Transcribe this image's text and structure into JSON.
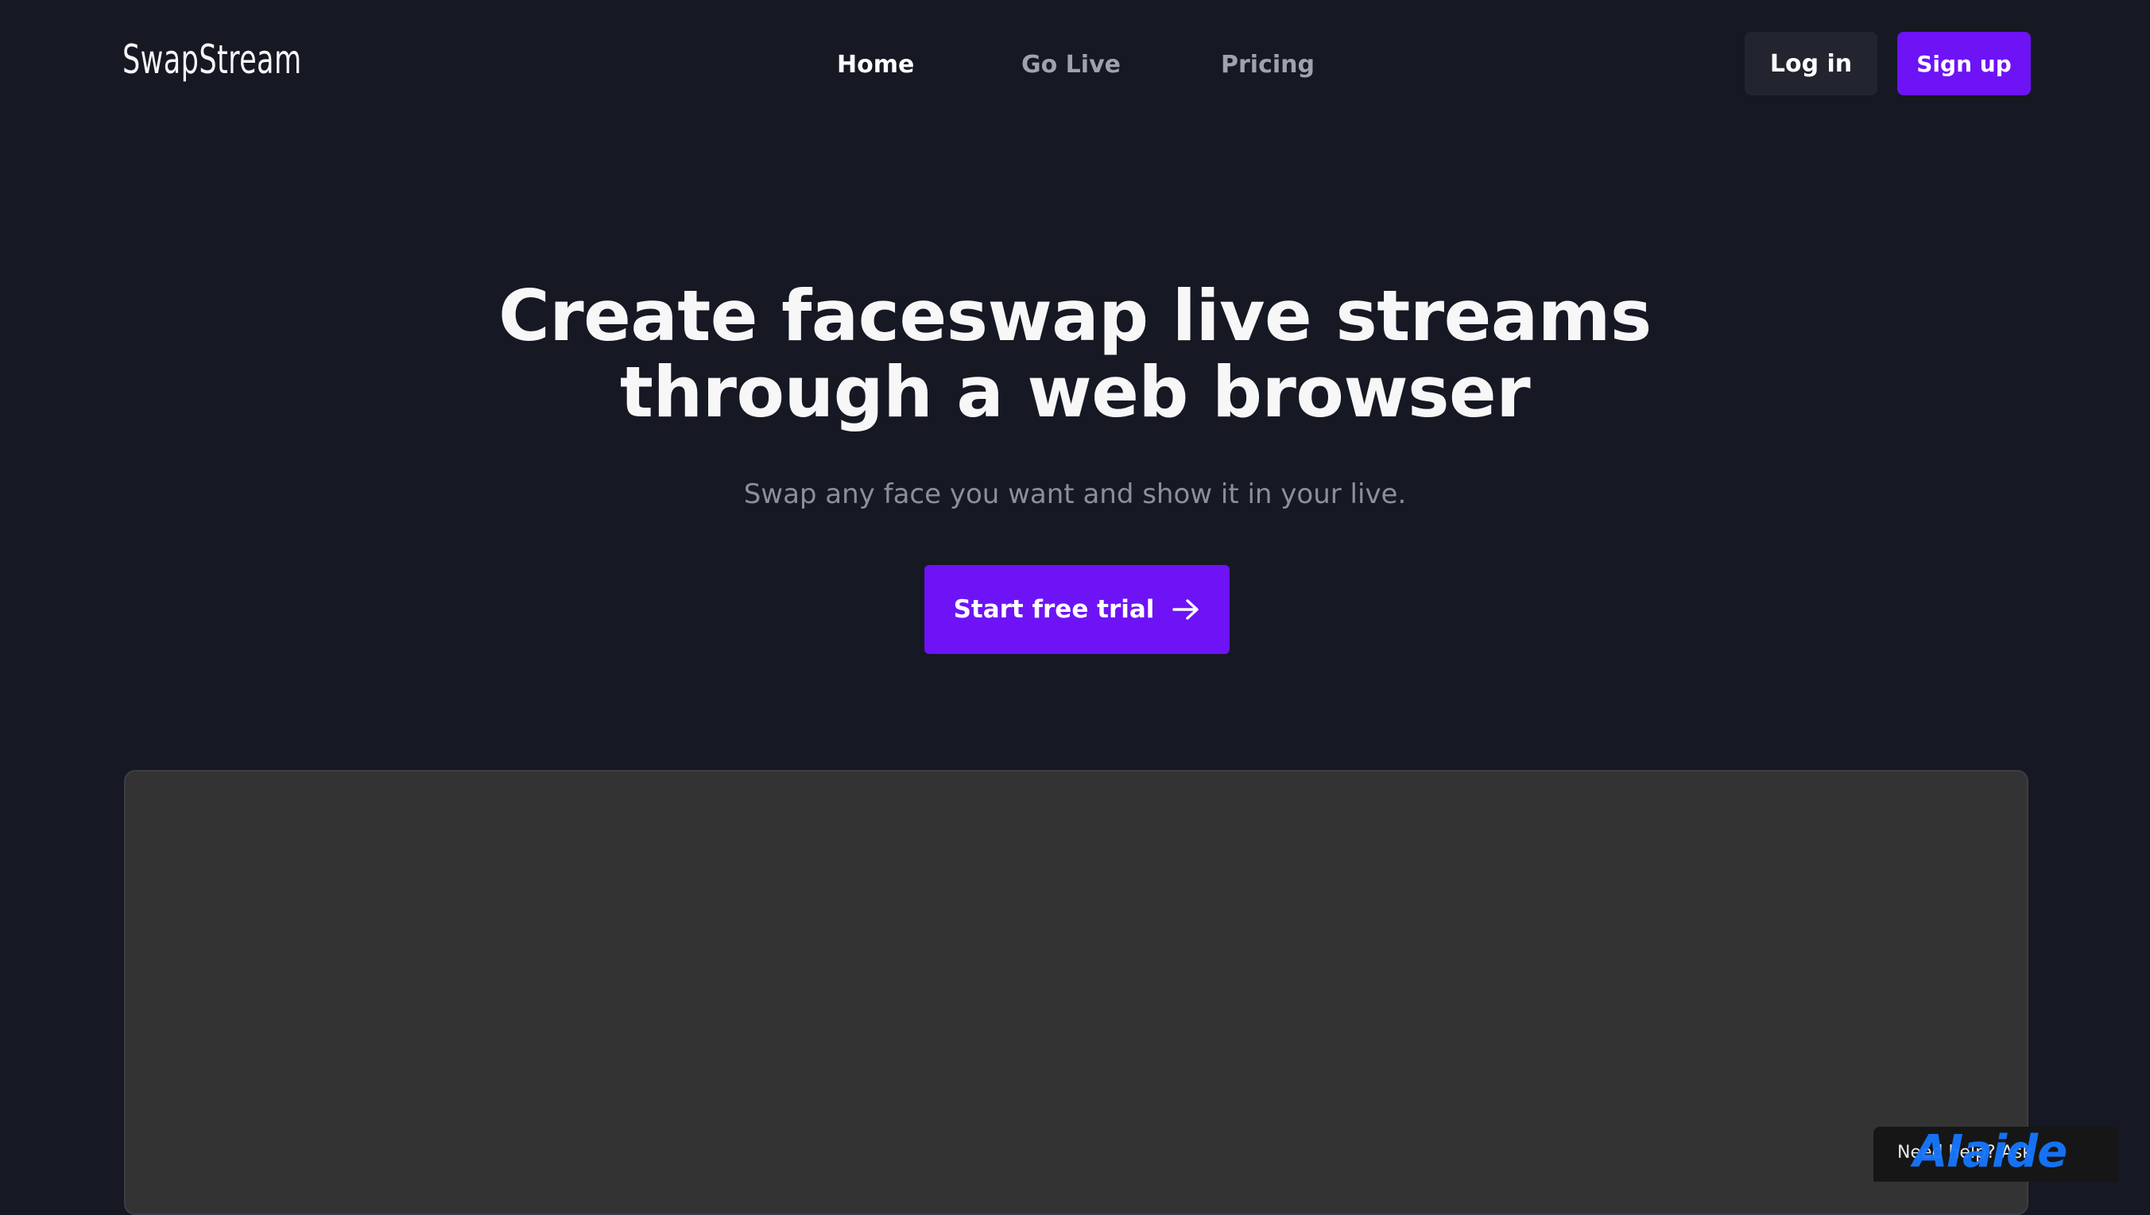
{
  "brand": {
    "logo_text": "SwapStream"
  },
  "nav": {
    "items": [
      {
        "label": "Home",
        "active": true
      },
      {
        "label": "Go Live",
        "active": false
      },
      {
        "label": "Pricing",
        "active": false
      }
    ]
  },
  "auth": {
    "login_label": "Log in",
    "signup_label": "Sign up"
  },
  "hero": {
    "title_line1": "Create faceswap live streams",
    "title_line2": "through a web browser",
    "subtitle": "Swap any face you want and show it in your live.",
    "cta_label": "Start free trial",
    "cta_icon": "arrow-right-icon"
  },
  "help_widget": {
    "text": "Need help? Ask",
    "brand": "AIaide"
  },
  "colors": {
    "background": "#161823",
    "accent": "#6d13f6",
    "login_bg": "#22242f",
    "preview_bg": "#333333",
    "muted_text": "#8b8f9c",
    "help_brand": "#1677ff"
  }
}
